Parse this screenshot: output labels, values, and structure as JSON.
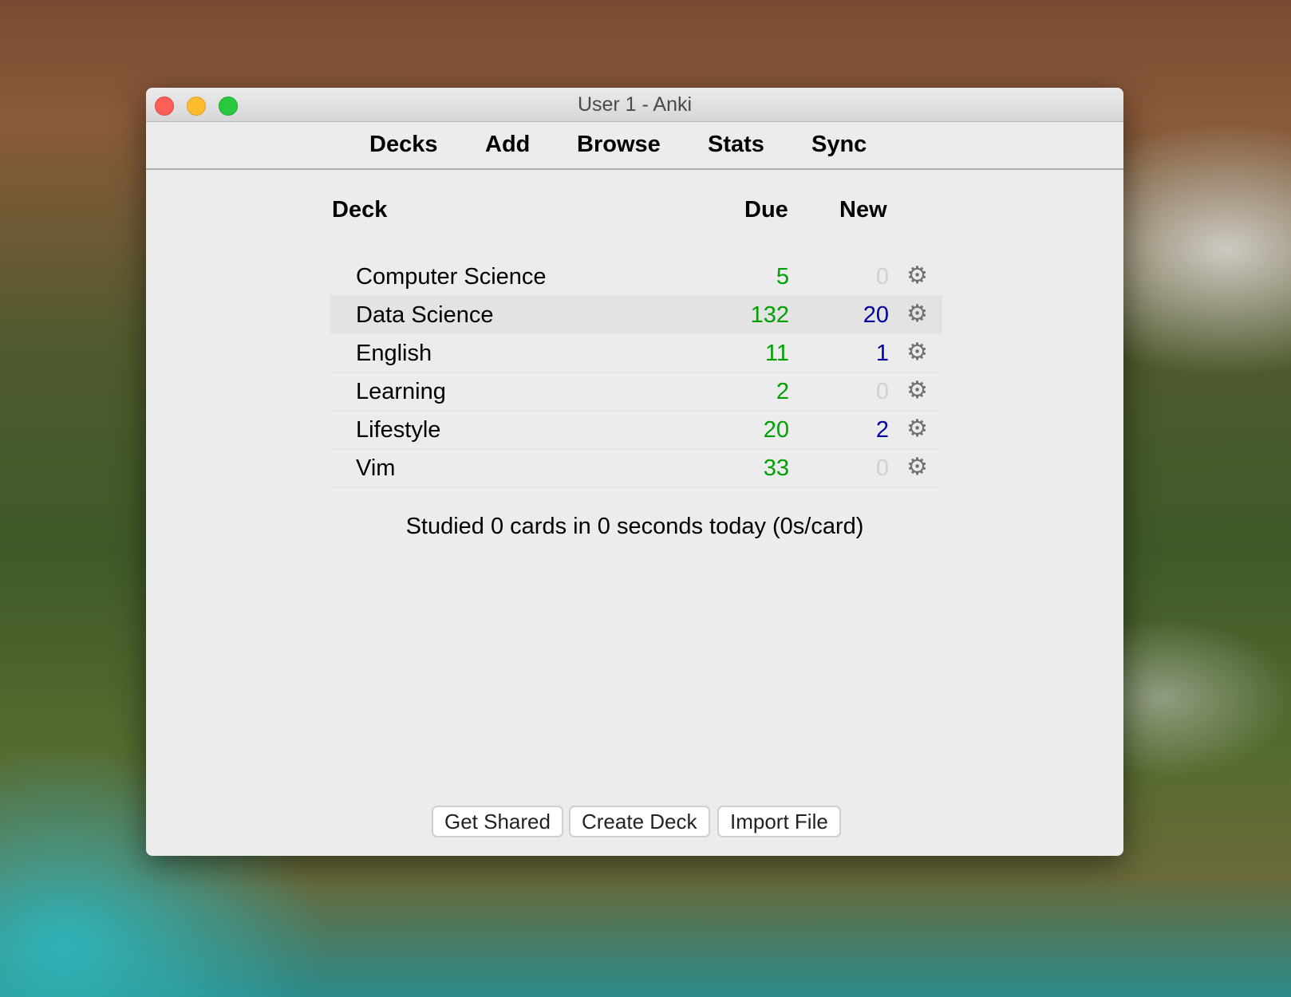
{
  "window": {
    "title": "User 1 - Anki"
  },
  "toolbar": {
    "items": [
      "Decks",
      "Add",
      "Browse",
      "Stats",
      "Sync"
    ]
  },
  "table": {
    "headers": {
      "deck": "Deck",
      "due": "Due",
      "new": "New"
    },
    "rows": [
      {
        "name": "Computer Science",
        "due": "5",
        "new": "0"
      },
      {
        "name": "Data Science",
        "due": "132",
        "new": "20"
      },
      {
        "name": "English",
        "due": "11",
        "new": "1"
      },
      {
        "name": "Learning",
        "due": "2",
        "new": "0"
      },
      {
        "name": "Lifestyle",
        "due": "20",
        "new": "2"
      },
      {
        "name": "Vim",
        "due": "33",
        "new": "0"
      }
    ]
  },
  "studied": "Studied 0 cards in 0 seconds today (0s/card)",
  "buttons": {
    "get_shared": "Get Shared",
    "create_deck": "Create Deck",
    "import_file": "Import File"
  },
  "colors": {
    "due": "#00a000",
    "new": "#0000a0",
    "zero": "#d0d0d0"
  }
}
